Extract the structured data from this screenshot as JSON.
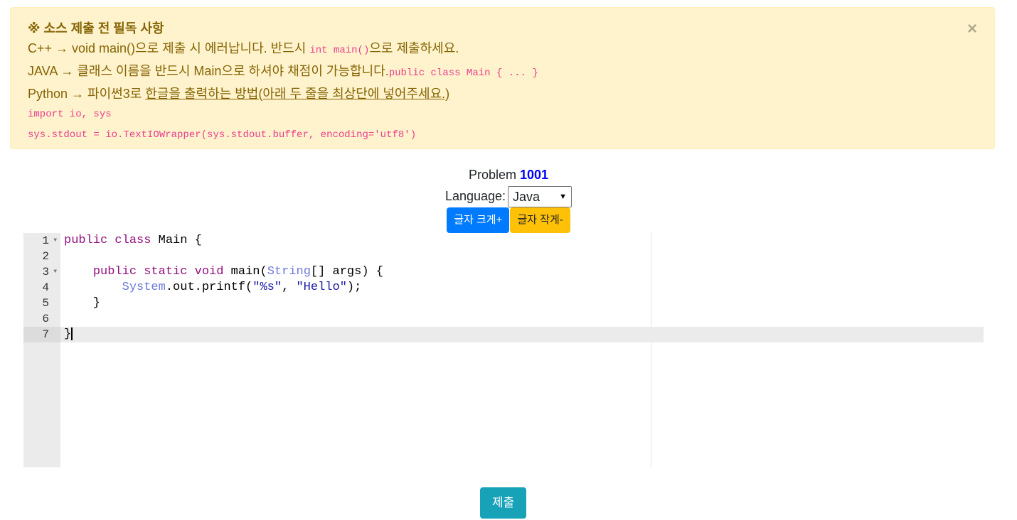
{
  "notice": {
    "title": "※ 소스 제출 전 필독 사항",
    "close_symbol": "×",
    "cpp_text": "C++ → void main()으로 제출 시 에러납니다. 반드시 ",
    "cpp_code": "int main()",
    "cpp_suffix": "으로 제출하세요.",
    "java_text": "JAVA → 클래스 이름을 반드시 Main으로 하셔야 채점이 가능합니다.",
    "java_code": "public class Main { ... }",
    "python_text": "Python → 파이썬3로 ",
    "python_link": "한글을 출력하는 방법(아래 두 줄을 최상단에 넣어주세요.)",
    "python_code_1": "import io, sys",
    "python_code_2": "sys.stdout = io.TextIOWrapper(sys.stdout.buffer, encoding='utf8')"
  },
  "problem": {
    "label": "Problem",
    "number": "1001"
  },
  "language": {
    "label": "Language:",
    "selected": "Java"
  },
  "font_buttons": {
    "increase": "글자 크게+",
    "decrease": "글자 작게-"
  },
  "editor": {
    "line_numbers": [
      "1",
      "2",
      "3",
      "4",
      "5",
      "6",
      "7"
    ],
    "active_line": 7
  },
  "submit": {
    "label": "제출"
  }
}
